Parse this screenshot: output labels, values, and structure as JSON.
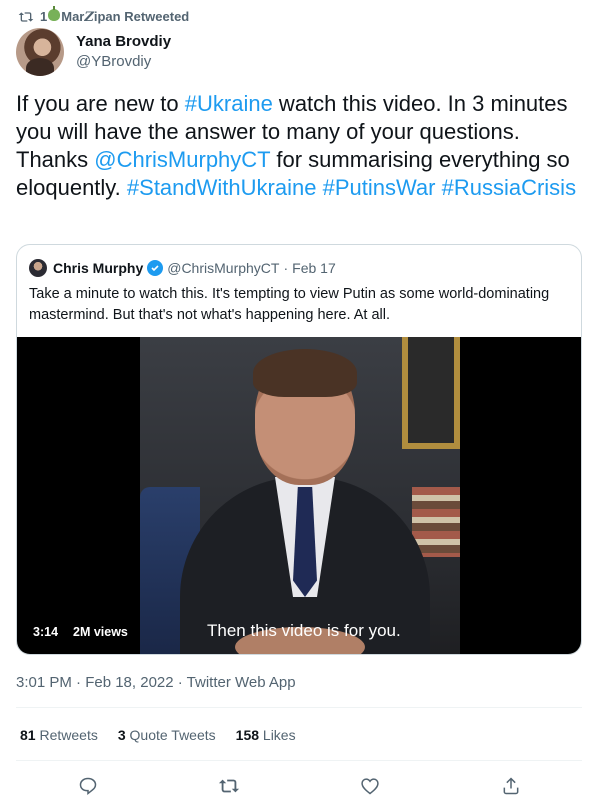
{
  "retweet_bar": {
    "icon": "retweet-icon",
    "count": "1",
    "name_part1": "Mar",
    "name_part2": "ipan",
    "name_emoji": "green-apple-icon",
    "italic_char": "Z",
    "suffix": "Retweeted"
  },
  "author": {
    "name": "Yana Brovdiy",
    "handle": "@YBrovdiy"
  },
  "tweet": {
    "segments": [
      {
        "text": "If you are new to ",
        "link": false
      },
      {
        "text": "#Ukraine",
        "link": true
      },
      {
        "text": " watch this video. In 3 minutes you will have the answer to many of your questions. Thanks ",
        "link": false
      },
      {
        "text": "@ChrisMurphyCT",
        "link": true
      },
      {
        "text": " for summarising everything so eloquently. ",
        "link": false
      },
      {
        "text": "#StandWithUkraine",
        "link": true
      },
      {
        "text": " ",
        "link": false
      },
      {
        "text": "#PutinsWar",
        "link": true
      },
      {
        "text": " ",
        "link": false
      },
      {
        "text": "#RussiaCrisis",
        "link": true
      }
    ]
  },
  "quote": {
    "name": "Chris Murphy",
    "handle": "@ChrisMurphyCT",
    "separator": "·",
    "date": "Feb 17",
    "text": "Take a minute to watch this. It's tempting to view Putin as some world-dominating mastermind. But that's not what's happening here. At all.",
    "video": {
      "duration": "3:14",
      "views": "2M views",
      "caption": "Then this video is for you."
    }
  },
  "meta": {
    "timestamp": "3:01 PM · Feb 18, 2022 · Twitter Web App"
  },
  "stats": {
    "retweets_count": "81",
    "retweets_label": "Retweets",
    "quotes_count": "3",
    "quotes_label": "Quote Tweets",
    "likes_count": "158",
    "likes_label": "Likes"
  },
  "actions": [
    "reply-icon",
    "retweet-icon",
    "like-icon",
    "share-icon"
  ],
  "colors": {
    "link": "#1d9bf0",
    "secondary_text": "#536471",
    "primary_text": "#0f1419",
    "border": "#cfd9de"
  }
}
